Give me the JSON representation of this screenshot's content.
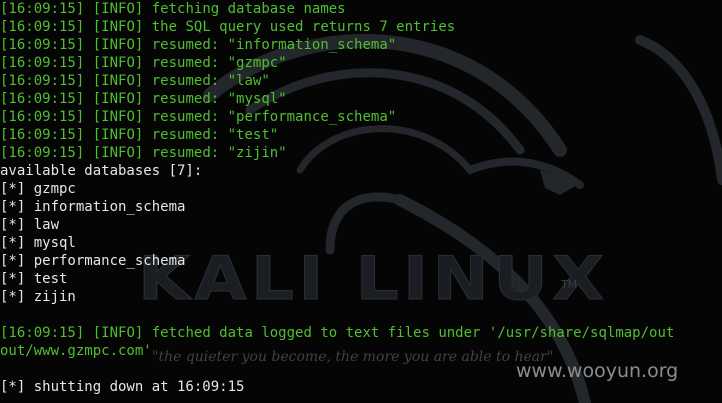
{
  "colors": {
    "log_text": "#4fbf2f",
    "plain_text": "#e6e6e6",
    "background": "#050505"
  },
  "log_lines": [
    {
      "time": "[16:09:15]",
      "level": "[INFO]",
      "message": "fetching database names"
    },
    {
      "time": "[16:09:15]",
      "level": "[INFO]",
      "message": "the SQL query used returns 7 entries"
    },
    {
      "time": "[16:09:15]",
      "level": "[INFO]",
      "message": "resumed: \"information_schema\""
    },
    {
      "time": "[16:09:15]",
      "level": "[INFO]",
      "message": "resumed: \"gzmpc\""
    },
    {
      "time": "[16:09:15]",
      "level": "[INFO]",
      "message": "resumed: \"law\""
    },
    {
      "time": "[16:09:15]",
      "level": "[INFO]",
      "message": "resumed: \"mysql\""
    },
    {
      "time": "[16:09:15]",
      "level": "[INFO]",
      "message": "resumed: \"performance_schema\""
    },
    {
      "time": "[16:09:15]",
      "level": "[INFO]",
      "message": "resumed: \"test\""
    },
    {
      "time": "[16:09:15]",
      "level": "[INFO]",
      "message": "resumed: \"zijin\""
    }
  ],
  "available_header": "available databases [7]:",
  "databases": [
    "[*] gzmpc",
    "[*] information_schema",
    "[*] law",
    "[*] mysql",
    "[*] performance_schema",
    "[*] test",
    "[*] zijin"
  ],
  "fetched_line": {
    "time": "[16:09:15]",
    "level": "[INFO]",
    "message": "fetched data logged to text files under '/usr/share/sqlmap/out",
    "continuation": "out/www.gzmpc.com'"
  },
  "shutdown_line": "[*] shutting down at 16:09:15",
  "background": {
    "logo_text": "KALI LINUX",
    "logo_tm": "TM",
    "tagline": "\"the quieter you become, the more you are able to hear\""
  },
  "watermark": "www.wooyun.org"
}
